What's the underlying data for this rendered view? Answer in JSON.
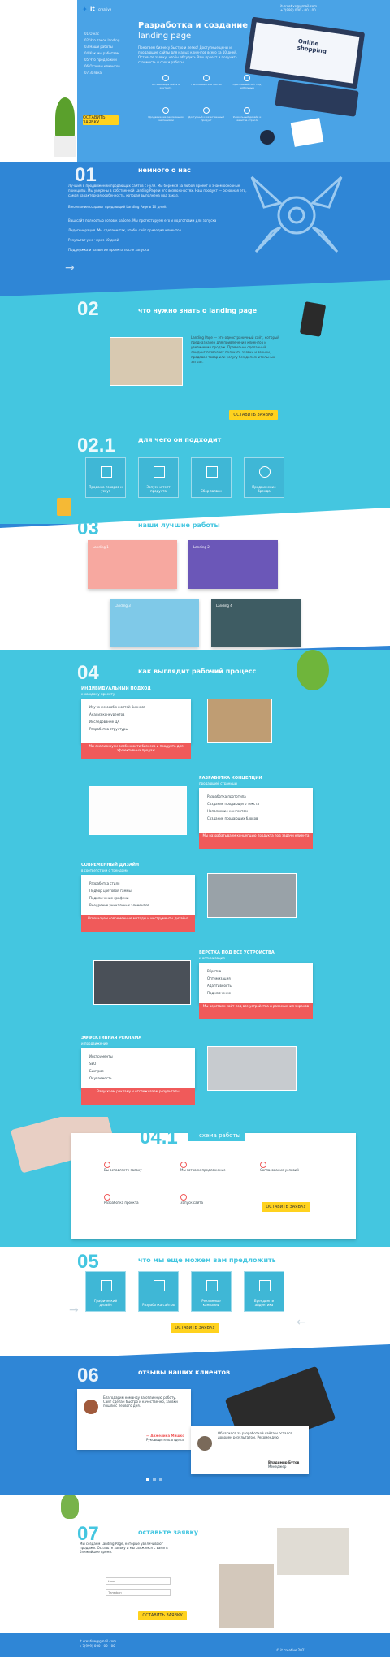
{
  "hero": {
    "brand": "it",
    "brand_sub": "creative",
    "title1": "Разработка и создание",
    "title2": "landing page",
    "lead": "Помогаем бизнесу быстро и легко! Доступные цены и продающие сайты для малых клиентов всего за 10 дней. Оставьте заявку, чтобы обсудить Ваш проект и получить стоимость и сроки работы.",
    "contacts": [
      "it.creative@gmail.com",
      "+7(999) 000 - 00 - 00"
    ],
    "monitor": "Online shopping",
    "button": "ОСТАВИТЬ ЗАЯВКУ",
    "nav": [
      "01 О нас",
      "02 Что такое landing",
      "03 Наши работы",
      "04 Как мы работаем",
      "05 Что предложим",
      "06 Отзывы клиентов",
      "07 Заявка"
    ],
    "features": [
      "Оптимизация сайта и контента",
      "Наполнение контентом",
      "Адаптивный сайт под мобильные",
      "Продвижение рекламными кампаниями",
      "Доступный и качественный продукт",
      "Уникальный дизайн и развитие отрасли"
    ]
  },
  "s1": {
    "num": "01",
    "title": "немного о нас",
    "p1": "Лучший в продвижении продающих сайтов с нуля. Мы беремся за любой проект и знаем основные принципы. Мы уверены в собственной Landing Page и его возможностях. Наш продукт — основная его, самая характерная особенность, которая выполнена под заказ.",
    "p2": "В компании создают продающий Landing Page в 10 дней:",
    "items": [
      "Ваш сайт полностью готов к работе. Мы протестируем его и подготовим для запуска",
      "Лидогенерация. Мы сделаем так, чтобы сайт приводил клиентов",
      "Результат уже через 10 дней",
      "Поддержка и развитие проекта после запуска"
    ]
  },
  "s2": {
    "num": "02",
    "title": "что нужно знать о landing page",
    "text": "Landing Page — это одностраничный сайт, который предназначен для привлечения клиентов и увеличения продаж. Правильно сделанный лендинг позволяет получать заявки и звонки, продавая товар или услугу без дополнительных затрат.",
    "button": "ОСТАВИТЬ ЗАЯВКУ"
  },
  "s2b": {
    "num": "02.1",
    "title": "для чего он подходит",
    "tiles": [
      "Продажа товаров и услуг",
      "Запуск и тест продукта",
      "Сбор заявок",
      "Продвижение бренда"
    ]
  },
  "s3": {
    "num": "03",
    "title": "наши лучшие работы",
    "cards": [
      "Landing 1",
      "Landing 2",
      "Landing 3",
      "Landing 4"
    ]
  },
  "s4": {
    "num": "04",
    "title": "как выглядит рабочий процесс",
    "blocks": [
      {
        "title": "ИНДИВИДУАЛЬНЫЙ ПОДХОД",
        "sub": "к каждому проекту",
        "items": [
          "Изучение особенностей бизнеса",
          "Анализ конкурентов",
          "Исследование ЦА",
          "Разработка структуры"
        ],
        "note": "Мы анализируем особенности бизнеса и продукта для эффективных продаж"
      },
      {
        "title": "РАЗРАБОТКА КОНЦЕПЦИИ",
        "sub": "продающей страницы",
        "items": [
          "Разработка прототипа",
          "Создание продающего текста",
          "Наполнение контентом",
          "Создание продающих блоков"
        ],
        "note": "Мы разрабатываем концепцию продукта под задачи клиента"
      },
      {
        "title": "СОВРЕМЕННЫЙ ДИЗАЙН",
        "sub": "в соответствии с трендами",
        "items": [
          "Разработка стиля",
          "Подбор цветовой гаммы",
          "Подключение графики",
          "Внедрение уникальных элементов"
        ],
        "note": "Используем современные методы и инструменты дизайна"
      },
      {
        "title": "ВЕРСТКА ПОД ВСЕ УСТРОЙСТВА",
        "sub": "и оптимизация",
        "items": [
          "Вёрстка",
          "Оптимизация",
          "Адаптивность",
          "Подключение"
        ],
        "note": "Мы верстаем сайт под все устройства и разрешения экранов"
      },
      {
        "title": "ЭФФЕКТИВНАЯ РЕКЛАМА",
        "sub": "и продвижение",
        "items": [
          "Инструменты",
          "SEO",
          "Быстрое",
          "Окупаемость"
        ],
        "note": "Запускаем рекламу и отслеживаем результаты"
      }
    ]
  },
  "s4b": {
    "num": "04.1",
    "title": "схема работы",
    "steps": [
      "Вы оставляете заявку",
      "Мы готовим предложение",
      "Согласование условий",
      "Разработка проекта",
      "Запуск сайта",
      "Поддержка"
    ],
    "button": "ОСТАВИТЬ ЗАЯВКУ"
  },
  "s5": {
    "num": "05",
    "title": "что мы еще можем вам предложить",
    "tiles": [
      "Графический дизайн",
      "Разработка сайтов",
      "Рекламные кампании",
      "Брендинг и айдентика"
    ],
    "button": "ОСТАВИТЬ ЗАЯВКУ"
  },
  "s6": {
    "num": "06",
    "title": "отзывы наших клиентов",
    "r1": "Благодарим команду за отличную работу. Сайт сделан быстро и качественно, заявки пошли с первого дня.",
    "r1n": "— Анжелика Мишко",
    "r1s": "Руководитель отдела",
    "r2": "Обратился за разработкой сайта и остался доволен результатом. Рекомендую.",
    "r2n": "Владимир Бутов",
    "r2s": "Менеджер"
  },
  "s7": {
    "num": "07",
    "title": "оставьте заявку",
    "text": "Мы создаем Landing Page, которые увеличивают продажи. Оставьте заявку и мы свяжемся с вами в ближайшее время.",
    "name_ph": "Имя",
    "phone_ph": "Телефон",
    "button": "ОСТАВИТЬ ЗАЯВКУ",
    "contacts": [
      "it.creative@gmail.com",
      "+7(999) 000 - 00 - 00"
    ],
    "copyright": "© it creative 2021"
  }
}
